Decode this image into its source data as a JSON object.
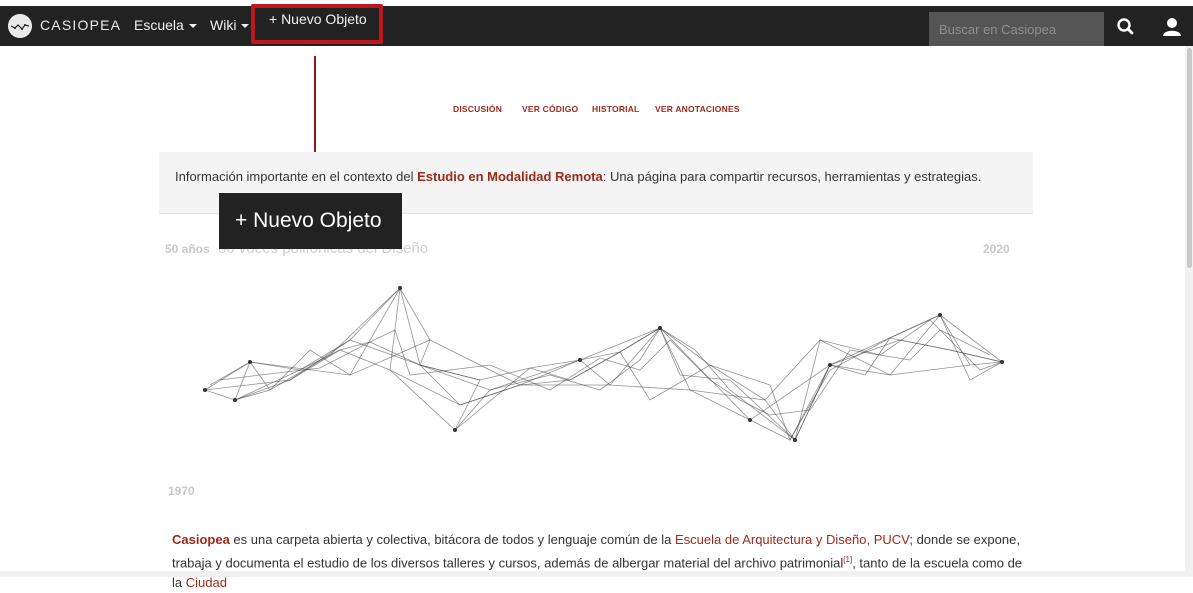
{
  "navbar": {
    "brand": "CASIOPEA",
    "menu": [
      {
        "label": "Escuela"
      },
      {
        "label": "Wiki"
      }
    ],
    "new_object": "+ Nuevo Objeto",
    "search_placeholder": "Buscar en Casiopea"
  },
  "tabs": [
    "DISCUSIÓN",
    "VER CÓDIGO",
    "HISTORIAL",
    "VER ANOTACIONES"
  ],
  "info": {
    "before": "Información importante en el contexto del ",
    "link": "Estudio en Modalidad Remota",
    "after": ": Una página para compartir recursos, herramientas y estrategias."
  },
  "tooltip": "+ Nuevo Objeto",
  "timeline": {
    "top_left": "50 años",
    "top_left_sub": "50 voces polifónicas del Diseño",
    "top_right": "2020",
    "bottom_left": "1970"
  },
  "paragraph": {
    "bold": "Casiopea",
    "t1": " es una carpeta abierta y colectiva, bitácora de todos y lenguaje común de la ",
    "link1": "Escuela de Arquitectura y Diseño, PUCV",
    "t2": "; donde se expone, trabaja y documenta el estudio de los diversos talleres y cursos, además de albergar material del archivo patrimonial",
    "sup": "[1]",
    "t3": ", tanto de la escuela como de la ",
    "link2": "Ciudad"
  },
  "colors": {
    "navbar": "#222222",
    "accent": "#9b2a1b",
    "highlight": "#c0161d"
  }
}
